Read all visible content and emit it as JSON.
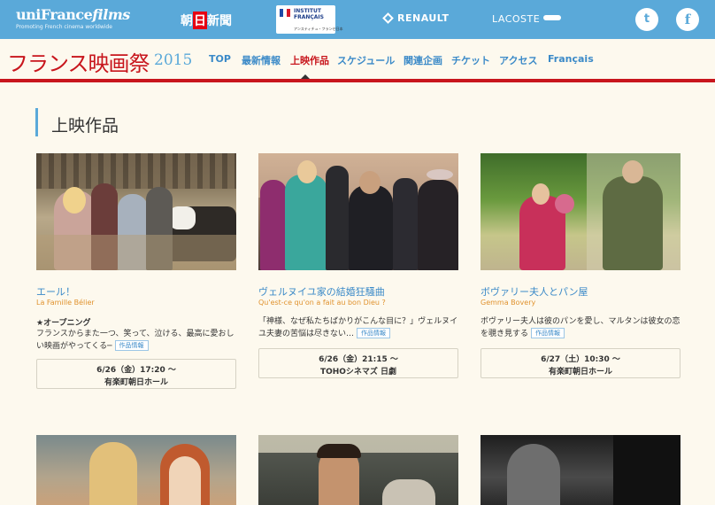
{
  "header": {
    "unifrance_name_1": "uniFrance",
    "unifrance_name_2": "films",
    "unifrance_tagline": "Promoting French cinema worldwide",
    "asahi_1": "朝",
    "asahi_2": "日",
    "asahi_3": "新聞",
    "institut_line1": "INSTITUT",
    "institut_line2": "FRANÇAIS",
    "institut_line3": "アンスティチュ・フランセ日本",
    "renault": "RENAULT",
    "lacoste": "LACOSTE",
    "twitter_glyph": "t",
    "facebook_glyph": "f"
  },
  "nav": {
    "logo": "フランス映画祭",
    "year": "2015",
    "items": [
      "TOP",
      "最新情報",
      "上映作品",
      "スケジュール",
      "関連企画",
      "チケット",
      "アクセス",
      "Français"
    ],
    "active_index": 2
  },
  "section": {
    "title": "上映作品"
  },
  "films": [
    {
      "title": "エール！",
      "original": "La Famille Bélier",
      "tag": "★オープニング",
      "desc": "フランスからまた一つ、笑って、泣ける、最高に愛おしい映画がやってくる─",
      "badge": "作品情報",
      "date": "6/26（金）17:20 〜",
      "venue": "有楽町朝日ホール"
    },
    {
      "title": "ヴェルヌイユ家の結婚狂騒曲",
      "original": "Qu'est-ce qu'on a fait au bon Dieu ?",
      "tag": "",
      "desc": "「神様、なぜ私たちばかりがこんな目に？」ヴェルヌイユ夫妻の苦悩は尽きない…",
      "badge": "作品情報",
      "date": "6/26（金）21:15 〜",
      "venue": "TOHOシネマズ 日劇"
    },
    {
      "title": "ボヴァリー夫人とパン屋",
      "original": "Gemma Bovery",
      "tag": "",
      "desc": "ボヴァリー夫人は彼のパンを愛し、マルタンは彼女の恋を覗き見する",
      "badge": "作品情報",
      "date": "6/27（土）10:30 〜",
      "venue": "有楽町朝日ホール"
    }
  ]
}
